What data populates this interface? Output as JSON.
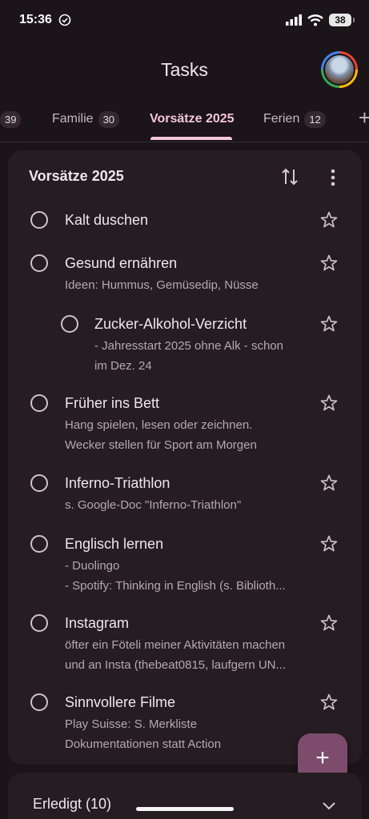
{
  "status": {
    "time": "15:36",
    "battery": "38"
  },
  "header": {
    "title": "Tasks"
  },
  "tabs": [
    {
      "label": "",
      "count": "39"
    },
    {
      "label": "Familie",
      "count": "30"
    },
    {
      "label": "Vorsätze 2025",
      "count": ""
    },
    {
      "label": "Ferien",
      "count": "12"
    }
  ],
  "list": {
    "title": "Vorsätze 2025",
    "tasks": [
      {
        "title": "Kalt duschen",
        "notes": []
      },
      {
        "title": "Gesund ernähren",
        "notes": [
          "Ideen: Hummus, Gemüsedip, Nüsse"
        ]
      },
      {
        "title": "Zucker-Alkohol-Verzicht",
        "notes": [
          "- Jahresstart 2025 ohne Alk - schon",
          "im Dez. 24"
        ],
        "subtask": true
      },
      {
        "title": "Früher ins Bett",
        "notes": [
          "Hang spielen, lesen oder zeichnen.",
          "Wecker stellen für Sport am Morgen"
        ]
      },
      {
        "title": "Inferno-Triathlon",
        "notes": [
          "s. Google-Doc \"Inferno-Triathlon\""
        ]
      },
      {
        "title": "Englisch lernen",
        "notes": [
          "- Duolingo",
          "- Spotify: Thinking in English (s. Biblioth..."
        ]
      },
      {
        "title": "Instagram",
        "notes": [
          "öfter ein Föteli meiner Aktivitäten machen",
          "und an Insta (thebeat0815, laufgern UN..."
        ]
      },
      {
        "title": "Sinnvollere Filme",
        "notes": [
          "Play Suisse: S. Merkliste",
          "Dokumentationen statt Action"
        ]
      }
    ]
  },
  "completed": {
    "label": "Erledigt (10)"
  },
  "fab": {
    "label": "+"
  },
  "colors": {
    "accent": "#f3c6dc",
    "fab": "#7d4b6c",
    "background": "#1b1418",
    "card": "#251d22"
  }
}
